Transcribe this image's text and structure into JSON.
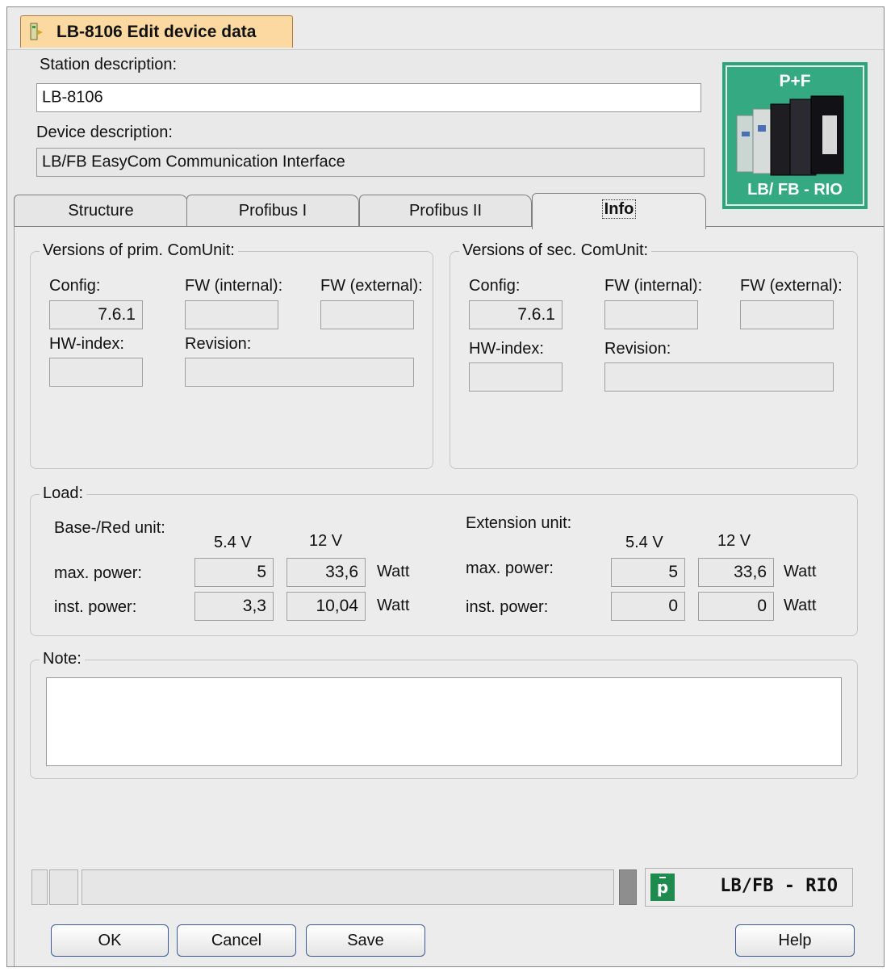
{
  "window": {
    "title": "LB-8106 Edit device data"
  },
  "station": {
    "label": "Station description:",
    "value": "LB-8106"
  },
  "device": {
    "label": "Device description:",
    "value": "LB/FB EasyCom Communication Interface"
  },
  "logo": {
    "top_text": "P+F",
    "bottom_text": "LB/ FB - RIO"
  },
  "tabs": [
    {
      "label": "Structure"
    },
    {
      "label": "Profibus I"
    },
    {
      "label": "Profibus II"
    },
    {
      "label": "Info",
      "active": true
    }
  ],
  "prim": {
    "title": "Versions of prim. ComUnit:",
    "config_label": "Config:",
    "config_value": "7.6.1",
    "fw_internal_label": "FW (internal):",
    "fw_external_label": "FW (external):",
    "hw_index_label": "HW-index:",
    "revision_label": "Revision:"
  },
  "sec": {
    "title": "Versions of sec. ComUnit:",
    "config_label": "Config:",
    "config_value": "7.6.1",
    "fw_internal_label": "FW (internal):",
    "fw_external_label": "FW (external):",
    "hw_index_label": "HW-index:",
    "revision_label": "Revision:"
  },
  "load": {
    "title": "Load:",
    "base": {
      "label": "Base-/Red unit:",
      "col1": "5.4 V",
      "col2": "12 V",
      "max_label": "max. power:",
      "max_54": "5",
      "max_12": "33,6",
      "inst_label": "inst. power:",
      "inst_54": "3,3",
      "inst_12": "10,04",
      "unit": "Watt"
    },
    "ext": {
      "label": "Extension unit:",
      "col1": "5.4 V",
      "col2": "12 V",
      "max_label": "max. power:",
      "max_54": "5",
      "max_12": "33,6",
      "inst_label": "inst. power:",
      "inst_54": "0",
      "inst_12": "0",
      "unit": "Watt"
    }
  },
  "note": {
    "label": "Note:",
    "value": ""
  },
  "status": {
    "brand": "LB/FB - RIO",
    "icon": "pepperl-fuchs-logo-icon"
  },
  "buttons": {
    "ok": "OK",
    "cancel": "Cancel",
    "save": "Save",
    "help": "Help"
  },
  "colors": {
    "title_tab": "#fcd9a0",
    "logo_green": "#35a981",
    "button_border": "#3c5a9a"
  }
}
